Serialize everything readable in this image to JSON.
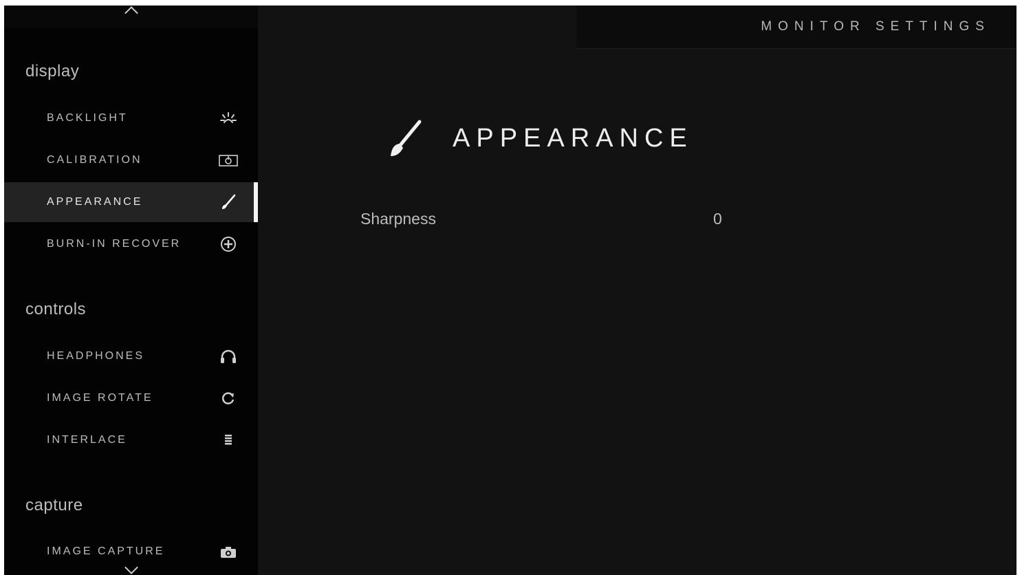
{
  "header": {
    "title": "MONITOR SETTINGS"
  },
  "sidebar": {
    "sections": [
      {
        "title": "display",
        "items": [
          {
            "label": "BACKLIGHT",
            "icon": "backlight-icon"
          },
          {
            "label": "CALIBRATION",
            "icon": "calibration-icon"
          },
          {
            "label": "APPEARANCE",
            "icon": "brush-icon",
            "active": true
          },
          {
            "label": "BURN-IN RECOVER",
            "icon": "burn-in-recover-icon"
          }
        ]
      },
      {
        "title": "controls",
        "items": [
          {
            "label": "HEADPHONES",
            "icon": "headphones-icon"
          },
          {
            "label": "IMAGE ROTATE",
            "icon": "rotate-icon"
          },
          {
            "label": "INTERLACE",
            "icon": "interlace-icon"
          }
        ]
      },
      {
        "title": "capture",
        "items": [
          {
            "label": "IMAGE CAPTURE",
            "icon": "camera-icon"
          }
        ]
      }
    ]
  },
  "main": {
    "page_title": "APPEARANCE",
    "page_icon": "brush-icon",
    "settings": [
      {
        "label": "Sharpness",
        "value": "0"
      }
    ]
  },
  "colors": {
    "background": "#121212",
    "sidebar": "#030303",
    "active_item": "#232323",
    "active_indicator": "#f4f4f4",
    "text": "#bdbdbd"
  }
}
